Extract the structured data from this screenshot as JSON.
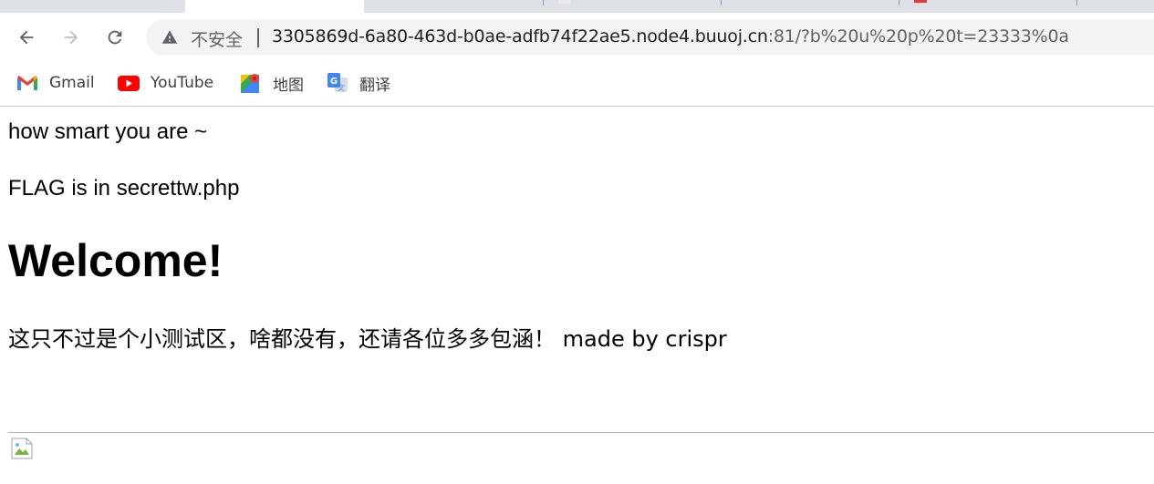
{
  "browser": {
    "omnibox": {
      "security_label": "不安全",
      "url_host": "3305869d-6a80-463d-b0ae-adfb74f22ae5.node4.buuoj.cn",
      "url_rest": ":81/?b%20u%20p%20t=23333%0a"
    },
    "bookmarks": [
      {
        "label": "Gmail",
        "icon": "gmail-icon"
      },
      {
        "label": "YouTube",
        "icon": "youtube-icon"
      },
      {
        "label": "地图",
        "icon": "maps-icon"
      },
      {
        "label": "翻译",
        "icon": "translate-icon"
      }
    ],
    "colors": {
      "tab_strip": "#dee1e6",
      "omnibox_bg": "#f1f3f4",
      "icon_gray": "#5f6368"
    }
  },
  "page": {
    "line1": "how smart you are ~",
    "line2": "FLAG is in secrettw.php",
    "heading": "Welcome!",
    "paragraph": "这只不过是个小测试区，啥都没有，还请各位多多包涵！ made by crispr"
  }
}
